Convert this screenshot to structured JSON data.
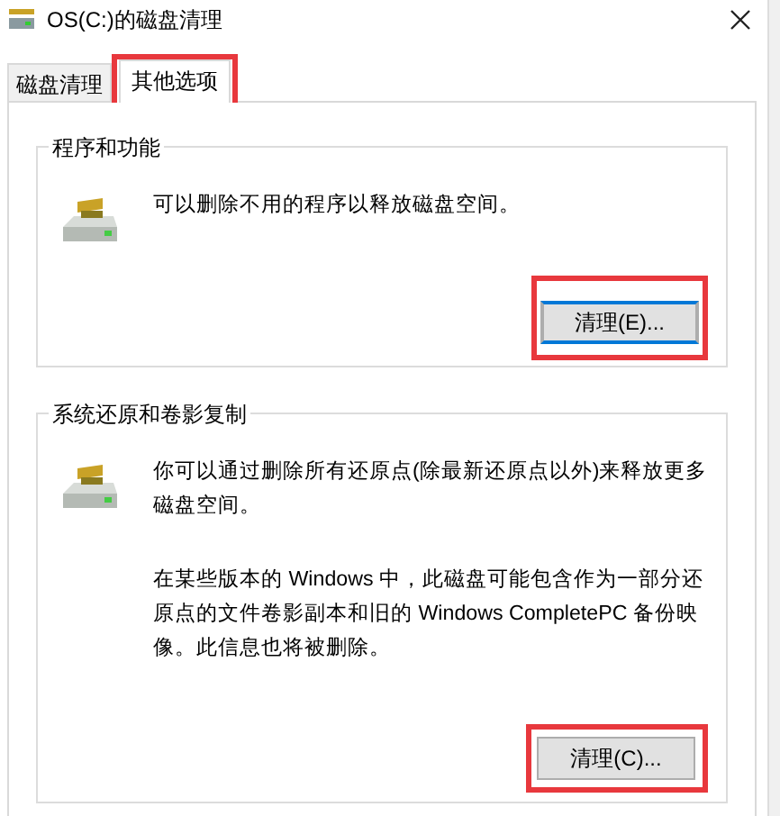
{
  "window": {
    "title": "OS(C:)的磁盘清理"
  },
  "tabs": [
    {
      "label": "磁盘清理",
      "selected": false
    },
    {
      "label": "其他选项",
      "selected": true
    }
  ],
  "groups": [
    {
      "title": "程序和功能",
      "paragraphs": [
        "可以删除不用的程序以释放磁盘空间。"
      ],
      "button": {
        "label": "清理(E)...",
        "default": true
      }
    },
    {
      "title": "系统还原和卷影复制",
      "paragraphs": [
        "你可以通过删除所有还原点(除最新还原点以外)来释放更多磁盘空间。",
        "在某些版本的 Windows 中，此磁盘可能包含作为一部分还原点的文件卷影副本和旧的 Windows CompletePC 备份映像。此信息也将被删除。"
      ],
      "button": {
        "label": "清理(C)...",
        "default": false
      }
    }
  ]
}
